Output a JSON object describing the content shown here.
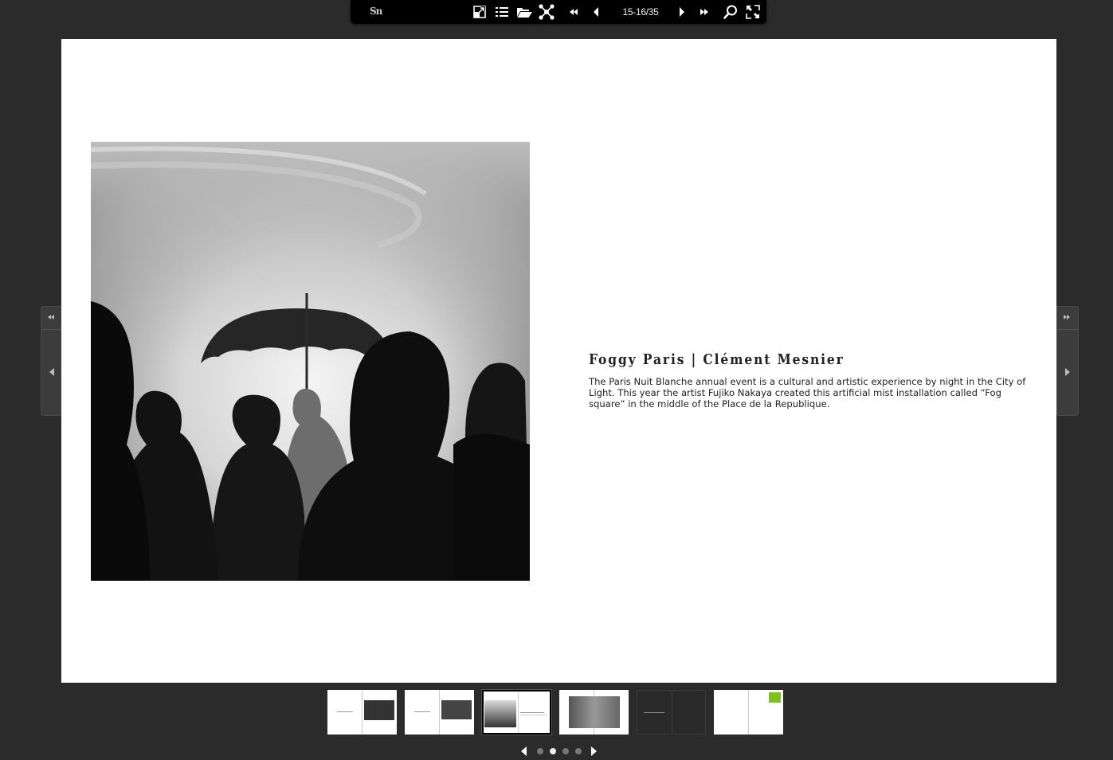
{
  "toolbar": {
    "logo": "Sn",
    "page_indicator": "15-16/35",
    "buttons": [
      {
        "name": "layout-icon"
      },
      {
        "name": "contents-list-icon"
      },
      {
        "name": "open-folder-icon"
      },
      {
        "name": "share-icon"
      },
      {
        "name": "first-page-icon"
      },
      {
        "name": "previous-page-icon"
      },
      {
        "name": "next-page-icon"
      },
      {
        "name": "last-page-icon"
      },
      {
        "name": "search-icon"
      },
      {
        "name": "fullscreen-icon"
      }
    ]
  },
  "article": {
    "title": "Foggy Paris | Clément Mesnier",
    "body": "The Paris Nuit Blanche annual event is a cultural and artistic experience by night in the City of Light. This year the artist Fujiko Nakaya created this artificial mist installation called “Fog square” in the middle of the Place de la Republique."
  },
  "thumbnails": {
    "count": 6,
    "active_index": 2
  },
  "pager": {
    "dots": 4,
    "active_index": 1
  },
  "colors": {
    "background": "#2b2b2b",
    "toolbar": "#000000",
    "page": "#ffffff",
    "thumb_dark": "#2a2a2a",
    "accent_green": "#7ac41c"
  }
}
